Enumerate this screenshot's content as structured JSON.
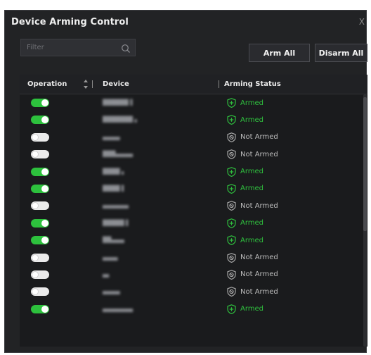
{
  "dialog": {
    "title": "Device Arming Control",
    "close_glyph": "X"
  },
  "filter": {
    "placeholder": "Filter",
    "value": ""
  },
  "buttons": {
    "arm_all": "Arm All",
    "disarm_all": "Disarm All"
  },
  "table": {
    "headers": {
      "operation": "Operation",
      "device": "Device",
      "arming_status": "Arming Status"
    },
    "rows": [
      {
        "enabled": true,
        "device": "██████ ▌",
        "status": "Armed"
      },
      {
        "enabled": true,
        "device": "███████ ▖",
        "status": "Armed"
      },
      {
        "enabled": false,
        "device": "▄▄▄▄",
        "status": "Not Armed"
      },
      {
        "enabled": false,
        "device": "███▄▄▄▄",
        "status": "Not Armed"
      },
      {
        "enabled": true,
        "device": "████ ▖",
        "status": "Armed"
      },
      {
        "enabled": true,
        "device": "████ ▌",
        "status": "Armed"
      },
      {
        "enabled": false,
        "device": "▄▄▄▄▄▄",
        "status": "Not Armed"
      },
      {
        "enabled": true,
        "device": "█████ ▌",
        "status": "Armed"
      },
      {
        "enabled": true,
        "device": "██▄▄▄",
        "status": "Armed"
      },
      {
        "enabled": false,
        "device": "▄▄▄▖",
        "status": "Not Armed"
      },
      {
        "enabled": false,
        "device": "▄▖",
        "status": "Not Armed"
      },
      {
        "enabled": false,
        "device": "▄▄▄▄",
        "status": "Not Armed"
      },
      {
        "enabled": true,
        "device": "▄▄▄▄▄▄▄",
        "status": "Armed"
      }
    ]
  },
  "colors": {
    "accent_green": "#2dc13d",
    "toggle_off": "#ebebeb",
    "dialog_bg": "#222325",
    "table_bg": "#1a1b1d"
  },
  "icons": {
    "search": "search-icon",
    "sort": "sort-arrows-icon",
    "armed": "shield-plus-icon",
    "not_armed": "shield-off-icon",
    "close": "close-icon"
  }
}
